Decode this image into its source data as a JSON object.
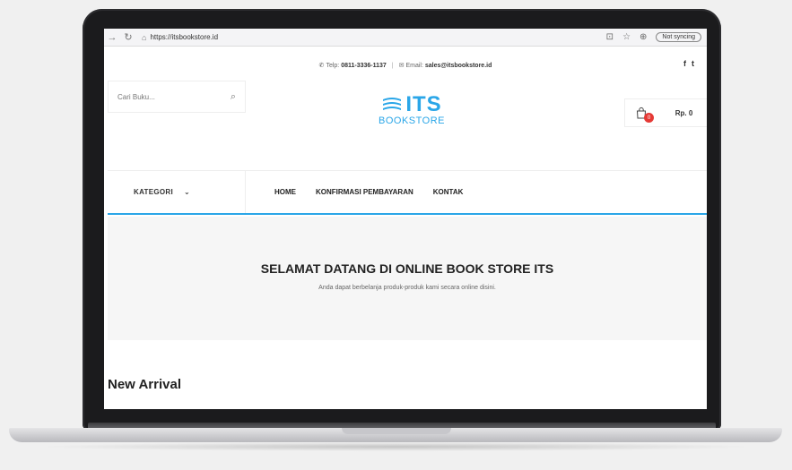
{
  "browser": {
    "url": "https://itsbookstore.id",
    "sync_label": "Not syncing"
  },
  "topbar": {
    "phone_label": "Telp:",
    "phone": "0811-3336-1137",
    "email_label": "Email:",
    "email": "sales@itsbookstore.id",
    "social": [
      "f",
      "t"
    ]
  },
  "header": {
    "search_placeholder": "Cari Buku...",
    "logo_main": "ITS",
    "logo_sub": "BOOKSTORE",
    "cart_count": "0",
    "cart_total": "Rp. 0"
  },
  "nav": {
    "kategori": "KATEGORI",
    "items": [
      "HOME",
      "KONFIRMASI PEMBAYARAN",
      "KONTAK"
    ]
  },
  "hero": {
    "title": "SELAMAT DATANG DI ONLINE BOOK STORE ITS",
    "subtitle": "Anda dapat berbelanja produk-produk kami secara online disini."
  },
  "section": {
    "title": "New Arrival"
  },
  "colors": {
    "brand": "#2aa6e8",
    "badge": "#e53935"
  }
}
